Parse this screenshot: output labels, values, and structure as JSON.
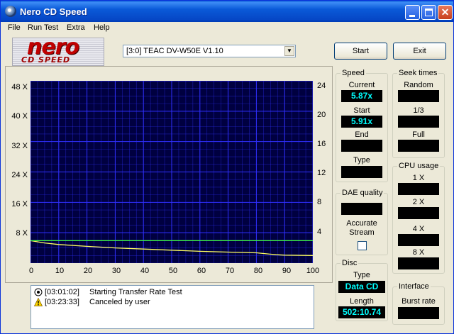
{
  "window": {
    "title": "Nero CD Speed"
  },
  "menu": {
    "file": "File",
    "run_test": "Run Test",
    "extra": "Extra",
    "help": "Help"
  },
  "logo": {
    "main": "nero",
    "sub": "CD SPEED"
  },
  "drive": {
    "selected": "[3:0]  TEAC DV-W50E V1.10"
  },
  "buttons": {
    "start": "Start",
    "exit": "Exit"
  },
  "chart": {
    "y_left": [
      "48 X",
      "40 X",
      "32 X",
      "24 X",
      "16 X",
      "8 X"
    ],
    "y_right": [
      "24",
      "20",
      "16",
      "12",
      "8",
      "4"
    ],
    "x": [
      "0",
      "10",
      "20",
      "30",
      "40",
      "50",
      "60",
      "70",
      "80",
      "90",
      "100"
    ]
  },
  "chart_data": {
    "type": "line",
    "xlim": [
      0,
      100
    ],
    "ylim": [
      0,
      48
    ],
    "ylim_right": [
      0,
      24
    ],
    "x_ticks": [
      0,
      10,
      20,
      30,
      40,
      50,
      60,
      70,
      80,
      90,
      100
    ],
    "y_ticks": [
      8,
      16,
      24,
      32,
      40,
      48
    ],
    "y_right_ticks": [
      4,
      8,
      12,
      16,
      20,
      24
    ],
    "series": [
      {
        "color": "#ffff60",
        "x": [
          0,
          5,
          10,
          20,
          30,
          40,
          50,
          60,
          70,
          80,
          87,
          90,
          100
        ],
        "values": [
          5.91,
          5.3,
          4.9,
          4.4,
          4.0,
          3.7,
          3.4,
          3.1,
          2.9,
          2.7,
          2.2,
          2.1,
          2.0
        ]
      },
      {
        "color": "#40ff40",
        "x": [
          0,
          100
        ],
        "values": [
          5.9,
          5.9
        ]
      }
    ],
    "grid": true,
    "background": "#000040",
    "grid_color": "#3030ff"
  },
  "log": [
    {
      "icon": "info-icon",
      "time": "[03:01:02]",
      "message": "Starting Transfer Rate Test"
    },
    {
      "icon": "warning-icon",
      "time": "[03:23:33]",
      "message": "Canceled by user"
    }
  ],
  "speed": {
    "title": "Speed",
    "current_label": "Current",
    "current": "5.87x",
    "start_label": "Start",
    "start": "5.91x",
    "end_label": "End",
    "end": "",
    "type_label": "Type",
    "type": ""
  },
  "seek": {
    "title": "Seek times",
    "random": "Random",
    "third": "1/3",
    "full": "Full"
  },
  "dae": {
    "title": "DAE quality",
    "accurate_stream": "Accurate Stream"
  },
  "cpu": {
    "title": "CPU usage",
    "x1": "1 X",
    "x2": "2 X",
    "x4": "4 X",
    "x8": "8 X"
  },
  "disc": {
    "title": "Disc",
    "type_label": "Type",
    "type": "Data CD",
    "length_label": "Length",
    "length": "502:10.74"
  },
  "interface": {
    "title": "Interface",
    "burst_rate": "Burst rate"
  }
}
